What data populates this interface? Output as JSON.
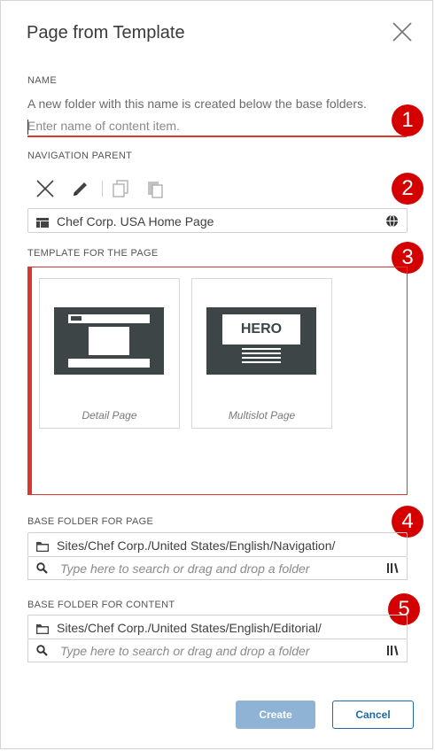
{
  "dialog": {
    "title": "Page from Template"
  },
  "name_section": {
    "label": "NAME",
    "description": "A new folder with this name is created below the base folders.",
    "placeholder": "Enter name of content item."
  },
  "navigation_section": {
    "label": "NAVIGATION PARENT",
    "value": "Chef Corp. USA Home Page"
  },
  "template_section": {
    "label": "TEMPLATE FOR THE PAGE",
    "templates": [
      {
        "caption": "Detail Page"
      },
      {
        "caption": "Multislot Page",
        "thumb_text": "HERO"
      }
    ]
  },
  "base_page_section": {
    "label": "BASE FOLDER FOR PAGE",
    "path": "Sites/Chef Corp./United States/English/Navigation/",
    "search_placeholder": "Type here to search or drag and drop a folder"
  },
  "base_content_section": {
    "label": "BASE FOLDER FOR CONTENT",
    "path": "Sites/Chef Corp./United States/English/Editorial/",
    "search_placeholder": "Type here to search or drag and drop a folder"
  },
  "badges": [
    "1",
    "2",
    "3",
    "4",
    "5"
  ],
  "footer": {
    "create_label": "Create",
    "cancel_label": "Cancel"
  },
  "colors": {
    "accent_red": "#d9382f",
    "badge_red": "#d40000",
    "primary_blue": "#1e6aa8",
    "disabled_blue": "#8fb3d4"
  }
}
